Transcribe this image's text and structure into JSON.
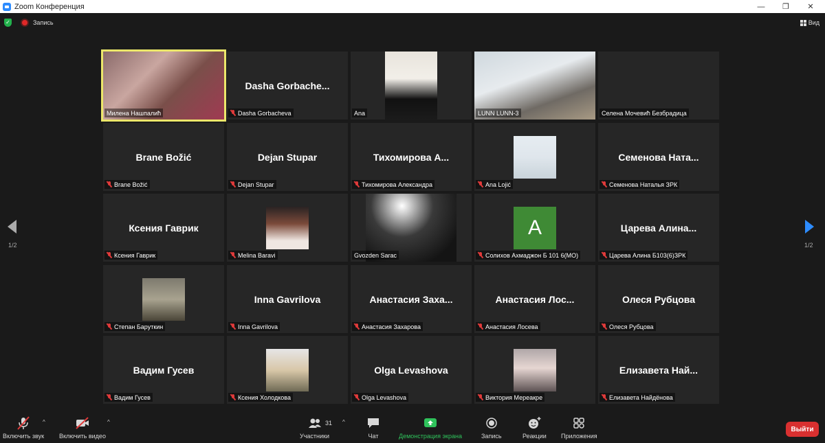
{
  "window": {
    "title": "Zoom Конференция",
    "minimize_glyph": "—",
    "restore_glyph": "❐",
    "close_glyph": "✕"
  },
  "topbar": {
    "recording_label": "Запись",
    "view_label": "Вид"
  },
  "pagination": {
    "left": "1/2",
    "right": "1/2"
  },
  "tiles": [
    {
      "big": "",
      "label": "Милена Нашпалић",
      "muted": false
    },
    {
      "big": "Dasha Gorbache...",
      "label": "Dasha Gorbacheva",
      "muted": true
    },
    {
      "big": "",
      "label": "Ana",
      "muted": false
    },
    {
      "big": "",
      "label": "LUNN LUNN-3",
      "muted": false
    },
    {
      "big": "",
      "label": "Селена Мочевић Безбрадица",
      "muted": false
    },
    {
      "big": "Brane Božić",
      "label": "Brane Božić",
      "muted": true
    },
    {
      "big": "Dejan Stupar",
      "label": "Dejan Stupar",
      "muted": true
    },
    {
      "big": "Тихомирова А...",
      "label": "Тихомирова Александра",
      "muted": true
    },
    {
      "big": "",
      "label": "Ana Lojić",
      "muted": true
    },
    {
      "big": "Семенова Ната...",
      "label": "Семенова Наталья ЗРК",
      "muted": true
    },
    {
      "big": "Ксения Гаврик",
      "label": "Ксения Гаврик",
      "muted": true
    },
    {
      "big": "",
      "label": "Melina Baravi",
      "muted": true
    },
    {
      "big": "",
      "label": "Gvozden Sarac",
      "muted": false
    },
    {
      "big": "",
      "label": "Солихов Ахмаджон Б 101 6(МО)",
      "muted": true,
      "avatar_letter": "A"
    },
    {
      "big": "Царева Алина...",
      "label": "Царева Алина Б103(6)ЗРК",
      "muted": true
    },
    {
      "big": "",
      "label": "Степан Баруткин",
      "muted": true
    },
    {
      "big": "Inna Gavrilova",
      "label": "Inna Gavrilova",
      "muted": true
    },
    {
      "big": "Анастасия Заха...",
      "label": "Анастасия Захарова",
      "muted": true
    },
    {
      "big": "Анастасия Лос...",
      "label": "Анастасия Лосева",
      "muted": true
    },
    {
      "big": "Олеся Рубцова",
      "label": "Олеся Рубцова",
      "muted": true
    },
    {
      "big": "Вадим Гусев",
      "label": "Вадим Гусев",
      "muted": true
    },
    {
      "big": "",
      "label": "Ксения Холодкова",
      "muted": true
    },
    {
      "big": "Olga Levashova",
      "label": "Olga Levashova",
      "muted": true
    },
    {
      "big": "",
      "label": "Виктория Мереакре",
      "muted": true
    },
    {
      "big": "Елизавета Най...",
      "label": "Елизавета Найдёнова",
      "muted": true
    }
  ],
  "toolbar": {
    "unmute": "Включить звук",
    "start_video": "Включить видео",
    "participants": "Участники",
    "participants_count": "31",
    "chat": "Чат",
    "share": "Демонстрация экрана",
    "record": "Запись",
    "reactions": "Реакции",
    "apps": "Приложения",
    "leave": "Выйти"
  },
  "colors": {
    "active_speaker": "#ece76a",
    "share_green": "#2fc25b",
    "leave_red": "#d93030",
    "accent_blue": "#2d8cff"
  }
}
